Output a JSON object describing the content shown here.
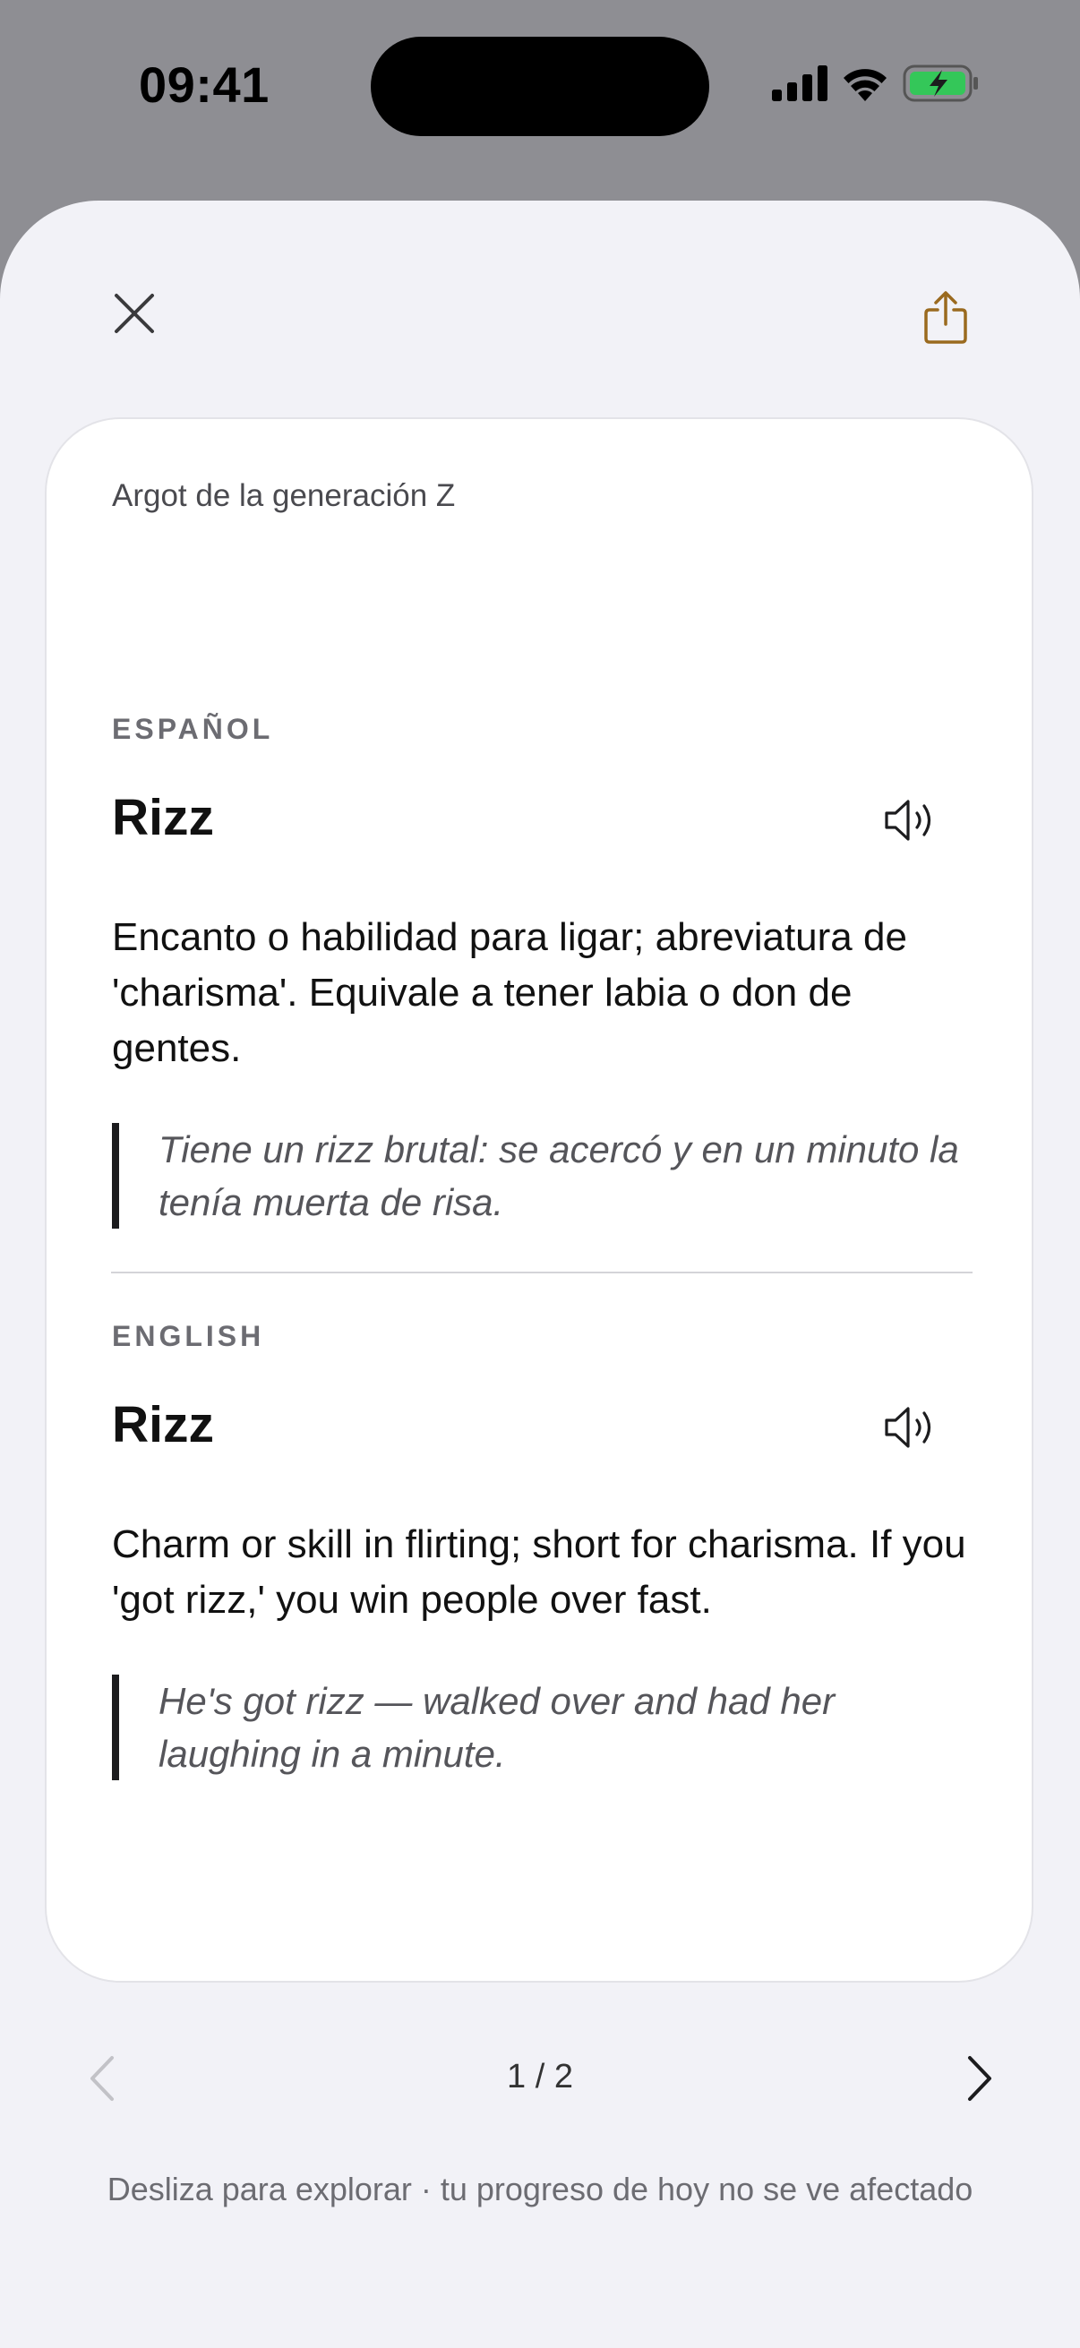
{
  "status_bar": {
    "time": "09:41",
    "icons": [
      "signal-icon",
      "wifi-icon",
      "battery-charging-icon"
    ]
  },
  "header": {
    "close_icon": "close-icon",
    "share_icon": "share-icon",
    "accent_color": "#9a6a1f"
  },
  "card": {
    "category": "Argot de la generación Z",
    "sections": [
      {
        "language": "ESPAÑOL",
        "term": "Rizz",
        "definition": "Encanto o habilidad para ligar; abreviatura de 'charisma'. Equivale a tener labia o don de gentes.",
        "example": "Tiene un rizz brutal: se acercó y en un minuto la tenía muerta de risa."
      },
      {
        "language": "ENGLISH",
        "term": "Rizz",
        "definition": "Charm or skill in flirting; short for charisma. If you 'got rizz,' you win people over fast.",
        "example": "He's got rizz — walked over and had her laughing in a minute."
      }
    ]
  },
  "pager": {
    "count": "1 / 2",
    "current": 1,
    "total": 2
  },
  "footer": {
    "hint": "Desliza para explorar · tu progreso de hoy no se ve afectado"
  }
}
